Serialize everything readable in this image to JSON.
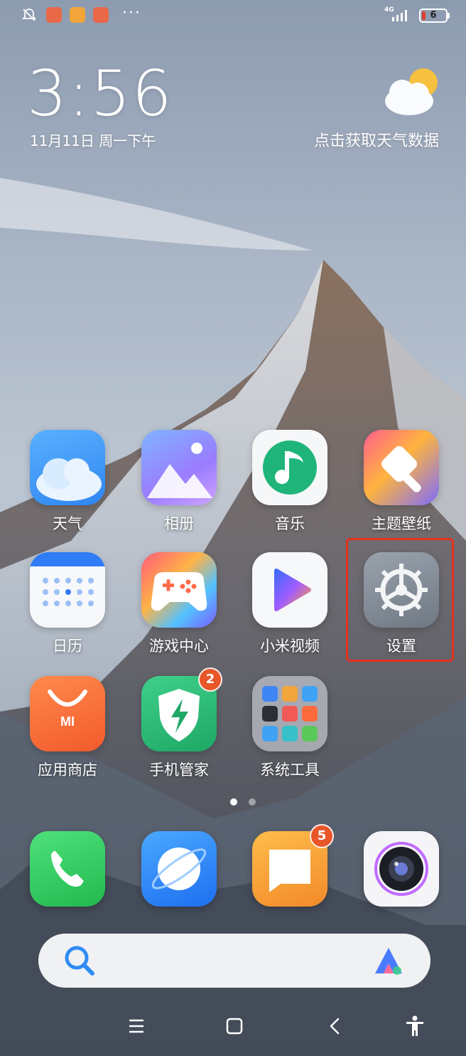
{
  "status_bar": {
    "network": "4G",
    "battery": "6",
    "more": "···"
  },
  "clock": {
    "time": "3:56",
    "date": "11月11日 周一下午"
  },
  "weather": {
    "prompt": "点击获取天气数据"
  },
  "apps": [
    {
      "label": "天气",
      "icon": "weather-icon"
    },
    {
      "label": "相册",
      "icon": "gallery-icon"
    },
    {
      "label": "音乐",
      "icon": "music-icon"
    },
    {
      "label": "主题壁纸",
      "icon": "themes-icon"
    },
    {
      "label": "日历",
      "icon": "calendar-icon"
    },
    {
      "label": "游戏中心",
      "icon": "game-center-icon"
    },
    {
      "label": "小米视频",
      "icon": "video-icon"
    },
    {
      "label": "设置",
      "icon": "settings-icon"
    },
    {
      "label": "应用商店",
      "icon": "app-store-icon"
    },
    {
      "label": "手机管家",
      "icon": "security-icon",
      "badge": "2"
    },
    {
      "label": "系统工具",
      "icon": "folder-icon"
    }
  ],
  "dock": [
    {
      "icon": "phone-icon"
    },
    {
      "icon": "browser-icon"
    },
    {
      "icon": "messages-icon",
      "badge": "5"
    },
    {
      "icon": "camera-icon"
    }
  ],
  "colors": {
    "highlight": "#e53020",
    "badge": "#e8562a"
  }
}
